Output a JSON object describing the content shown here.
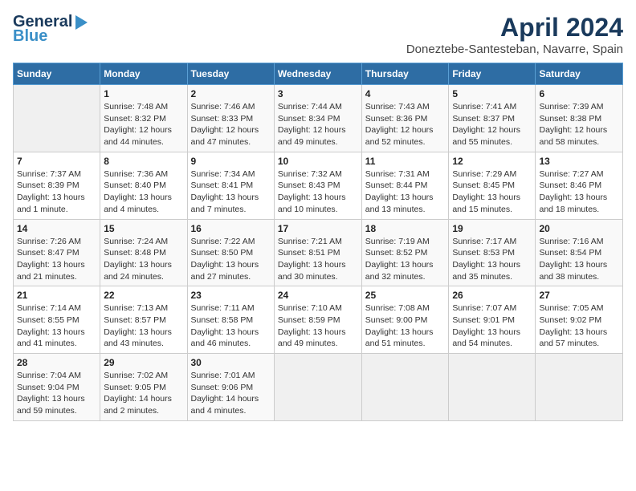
{
  "logo": {
    "line1": "General",
    "line2": "Blue"
  },
  "title": "April 2024",
  "subtitle": "Doneztebe-Santesteban, Navarre, Spain",
  "headers": [
    "Sunday",
    "Monday",
    "Tuesday",
    "Wednesday",
    "Thursday",
    "Friday",
    "Saturday"
  ],
  "rows": [
    [
      {
        "day": "",
        "sunrise": "",
        "sunset": "",
        "daylight": ""
      },
      {
        "day": "1",
        "sunrise": "Sunrise: 7:48 AM",
        "sunset": "Sunset: 8:32 PM",
        "daylight": "Daylight: 12 hours and 44 minutes."
      },
      {
        "day": "2",
        "sunrise": "Sunrise: 7:46 AM",
        "sunset": "Sunset: 8:33 PM",
        "daylight": "Daylight: 12 hours and 47 minutes."
      },
      {
        "day": "3",
        "sunrise": "Sunrise: 7:44 AM",
        "sunset": "Sunset: 8:34 PM",
        "daylight": "Daylight: 12 hours and 49 minutes."
      },
      {
        "day": "4",
        "sunrise": "Sunrise: 7:43 AM",
        "sunset": "Sunset: 8:36 PM",
        "daylight": "Daylight: 12 hours and 52 minutes."
      },
      {
        "day": "5",
        "sunrise": "Sunrise: 7:41 AM",
        "sunset": "Sunset: 8:37 PM",
        "daylight": "Daylight: 12 hours and 55 minutes."
      },
      {
        "day": "6",
        "sunrise": "Sunrise: 7:39 AM",
        "sunset": "Sunset: 8:38 PM",
        "daylight": "Daylight: 12 hours and 58 minutes."
      }
    ],
    [
      {
        "day": "7",
        "sunrise": "Sunrise: 7:37 AM",
        "sunset": "Sunset: 8:39 PM",
        "daylight": "Daylight: 13 hours and 1 minute."
      },
      {
        "day": "8",
        "sunrise": "Sunrise: 7:36 AM",
        "sunset": "Sunset: 8:40 PM",
        "daylight": "Daylight: 13 hours and 4 minutes."
      },
      {
        "day": "9",
        "sunrise": "Sunrise: 7:34 AM",
        "sunset": "Sunset: 8:41 PM",
        "daylight": "Daylight: 13 hours and 7 minutes."
      },
      {
        "day": "10",
        "sunrise": "Sunrise: 7:32 AM",
        "sunset": "Sunset: 8:43 PM",
        "daylight": "Daylight: 13 hours and 10 minutes."
      },
      {
        "day": "11",
        "sunrise": "Sunrise: 7:31 AM",
        "sunset": "Sunset: 8:44 PM",
        "daylight": "Daylight: 13 hours and 13 minutes."
      },
      {
        "day": "12",
        "sunrise": "Sunrise: 7:29 AM",
        "sunset": "Sunset: 8:45 PM",
        "daylight": "Daylight: 13 hours and 15 minutes."
      },
      {
        "day": "13",
        "sunrise": "Sunrise: 7:27 AM",
        "sunset": "Sunset: 8:46 PM",
        "daylight": "Daylight: 13 hours and 18 minutes."
      }
    ],
    [
      {
        "day": "14",
        "sunrise": "Sunrise: 7:26 AM",
        "sunset": "Sunset: 8:47 PM",
        "daylight": "Daylight: 13 hours and 21 minutes."
      },
      {
        "day": "15",
        "sunrise": "Sunrise: 7:24 AM",
        "sunset": "Sunset: 8:48 PM",
        "daylight": "Daylight: 13 hours and 24 minutes."
      },
      {
        "day": "16",
        "sunrise": "Sunrise: 7:22 AM",
        "sunset": "Sunset: 8:50 PM",
        "daylight": "Daylight: 13 hours and 27 minutes."
      },
      {
        "day": "17",
        "sunrise": "Sunrise: 7:21 AM",
        "sunset": "Sunset: 8:51 PM",
        "daylight": "Daylight: 13 hours and 30 minutes."
      },
      {
        "day": "18",
        "sunrise": "Sunrise: 7:19 AM",
        "sunset": "Sunset: 8:52 PM",
        "daylight": "Daylight: 13 hours and 32 minutes."
      },
      {
        "day": "19",
        "sunrise": "Sunrise: 7:17 AM",
        "sunset": "Sunset: 8:53 PM",
        "daylight": "Daylight: 13 hours and 35 minutes."
      },
      {
        "day": "20",
        "sunrise": "Sunrise: 7:16 AM",
        "sunset": "Sunset: 8:54 PM",
        "daylight": "Daylight: 13 hours and 38 minutes."
      }
    ],
    [
      {
        "day": "21",
        "sunrise": "Sunrise: 7:14 AM",
        "sunset": "Sunset: 8:55 PM",
        "daylight": "Daylight: 13 hours and 41 minutes."
      },
      {
        "day": "22",
        "sunrise": "Sunrise: 7:13 AM",
        "sunset": "Sunset: 8:57 PM",
        "daylight": "Daylight: 13 hours and 43 minutes."
      },
      {
        "day": "23",
        "sunrise": "Sunrise: 7:11 AM",
        "sunset": "Sunset: 8:58 PM",
        "daylight": "Daylight: 13 hours and 46 minutes."
      },
      {
        "day": "24",
        "sunrise": "Sunrise: 7:10 AM",
        "sunset": "Sunset: 8:59 PM",
        "daylight": "Daylight: 13 hours and 49 minutes."
      },
      {
        "day": "25",
        "sunrise": "Sunrise: 7:08 AM",
        "sunset": "Sunset: 9:00 PM",
        "daylight": "Daylight: 13 hours and 51 minutes."
      },
      {
        "day": "26",
        "sunrise": "Sunrise: 7:07 AM",
        "sunset": "Sunset: 9:01 PM",
        "daylight": "Daylight: 13 hours and 54 minutes."
      },
      {
        "day": "27",
        "sunrise": "Sunrise: 7:05 AM",
        "sunset": "Sunset: 9:02 PM",
        "daylight": "Daylight: 13 hours and 57 minutes."
      }
    ],
    [
      {
        "day": "28",
        "sunrise": "Sunrise: 7:04 AM",
        "sunset": "Sunset: 9:04 PM",
        "daylight": "Daylight: 13 hours and 59 minutes."
      },
      {
        "day": "29",
        "sunrise": "Sunrise: 7:02 AM",
        "sunset": "Sunset: 9:05 PM",
        "daylight": "Daylight: 14 hours and 2 minutes."
      },
      {
        "day": "30",
        "sunrise": "Sunrise: 7:01 AM",
        "sunset": "Sunset: 9:06 PM",
        "daylight": "Daylight: 14 hours and 4 minutes."
      },
      {
        "day": "",
        "sunrise": "",
        "sunset": "",
        "daylight": ""
      },
      {
        "day": "",
        "sunrise": "",
        "sunset": "",
        "daylight": ""
      },
      {
        "day": "",
        "sunrise": "",
        "sunset": "",
        "daylight": ""
      },
      {
        "day": "",
        "sunrise": "",
        "sunset": "",
        "daylight": ""
      }
    ]
  ],
  "colors": {
    "header_bg": "#2e6da4",
    "header_text": "#ffffff",
    "title_color": "#1a3a5c"
  }
}
